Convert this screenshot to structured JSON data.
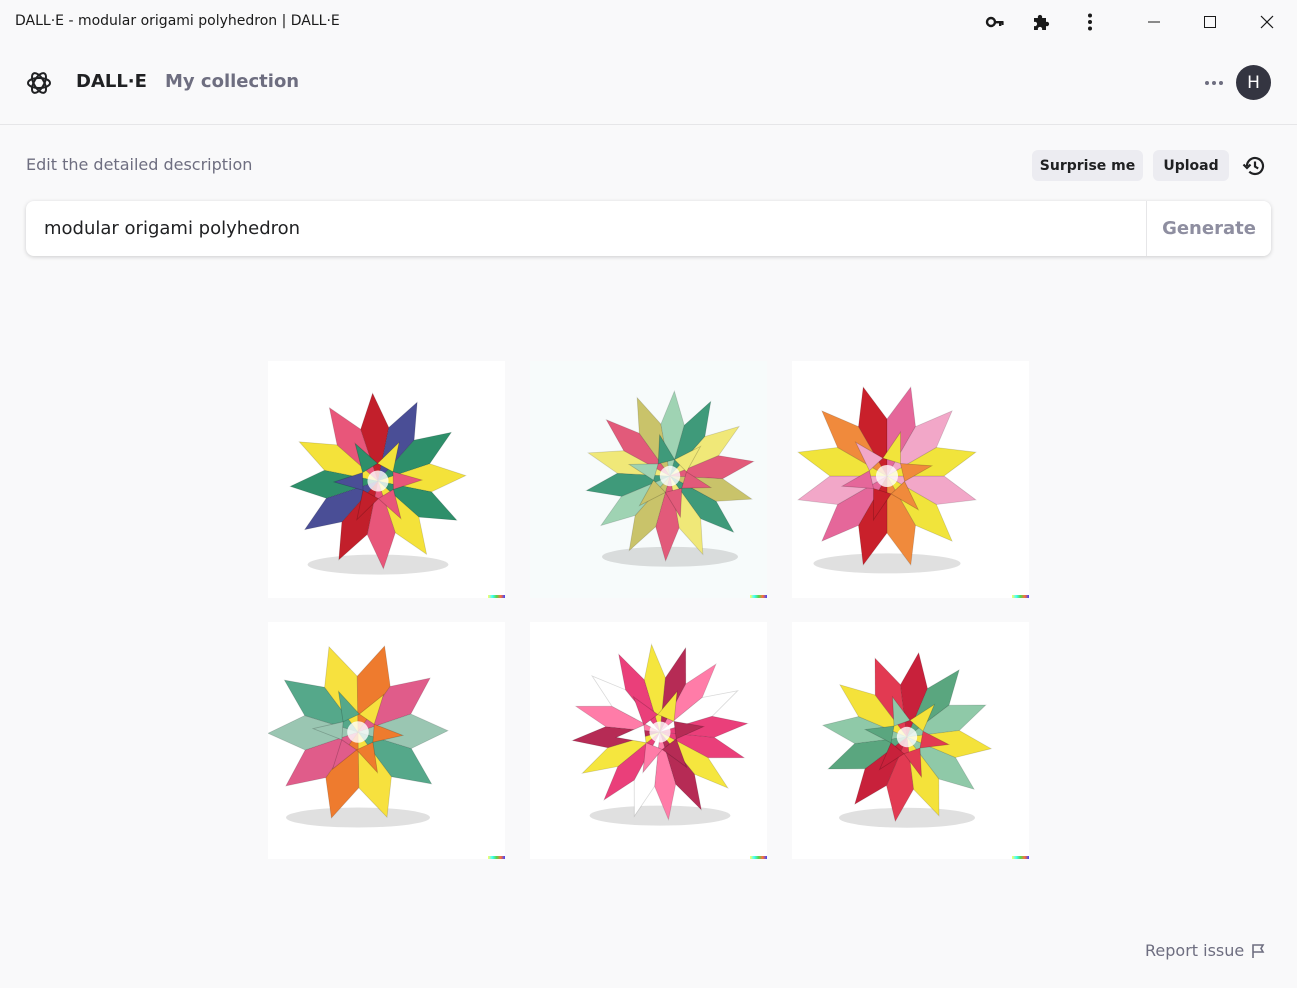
{
  "window": {
    "title": "DALL·E - modular origami polyhedron | DALL·E"
  },
  "browser_icons": [
    "key-icon",
    "puzzle-icon",
    "kebab-menu-icon"
  ],
  "window_controls": [
    "minimize-icon",
    "maximize-icon",
    "close-icon"
  ],
  "header": {
    "brand": "DALL·E",
    "nav_link": "My collection",
    "avatar_initial": "H"
  },
  "prompt": {
    "label": "Edit the detailed description",
    "surprise_label": "Surprise me",
    "upload_label": "Upload",
    "value": "modular origami polyhedron",
    "generate_label": "Generate"
  },
  "images": [
    {
      "colors": [
        "#2e8f6a",
        "#f4e23a",
        "#e8567a",
        "#c21f2b",
        "#4a4e96",
        "#ffffff"
      ]
    },
    {
      "colors": [
        "#3f9a7a",
        "#f0e878",
        "#e25a7a",
        "#c9c36a",
        "#9fd3b3",
        "#f7fbfb"
      ]
    },
    {
      "colors": [
        "#f2a7c8",
        "#f1e43b",
        "#f08a3c",
        "#c9202b",
        "#e5679a",
        "#ffffff"
      ]
    },
    {
      "colors": [
        "#55a88a",
        "#f7e13e",
        "#ee7b2e",
        "#e05c8a",
        "#9ac6b2",
        "#ffffff"
      ]
    },
    {
      "colors": [
        "#ea3f7a",
        "#f5e63e",
        "#b62b55",
        "#ff7ca8",
        "#ffffff",
        "#ffffff"
      ]
    },
    {
      "colors": [
        "#8fc9a8",
        "#f4e23a",
        "#e23a52",
        "#c8213b",
        "#5aa67f",
        "#ffffff"
      ]
    }
  ],
  "footer": {
    "report_label": "Report issue"
  }
}
